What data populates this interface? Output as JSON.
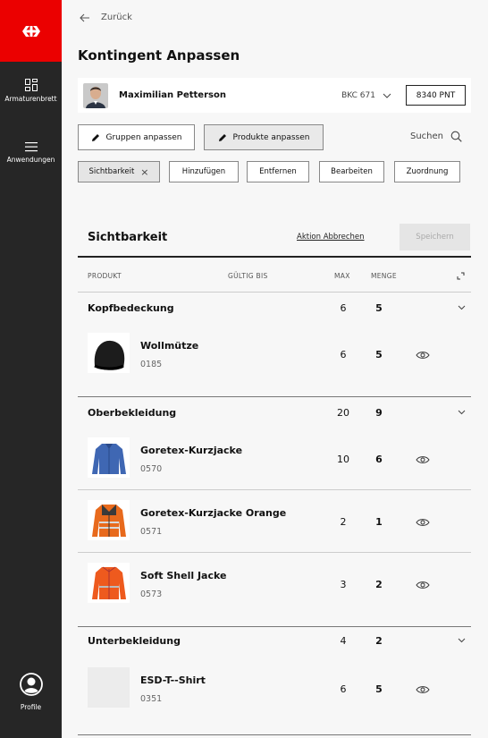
{
  "sidebar": {
    "items": [
      {
        "label": "Armaturenbrett",
        "icon": "dashboard-icon"
      },
      {
        "label": "Anwendungen",
        "icon": "menu-icon"
      },
      {
        "label": "Profile",
        "icon": "profile-icon"
      }
    ],
    "logo": "sbb-logo",
    "colors": {
      "brand": "#eb0000",
      "background": "#262626"
    }
  },
  "header": {
    "back_label": "Zurück",
    "title": "Kontingent Anpassen"
  },
  "user": {
    "name": "Maximilian Petterson",
    "account": "BKC 671",
    "points": "8340 PNT"
  },
  "actions": {
    "groups_label": "Gruppen anpassen",
    "products_label": "Produkte anpassen",
    "search_label": "Suchen"
  },
  "chips": [
    {
      "label": "Sichtbarkeit",
      "active": true
    },
    {
      "label": "Hinzufügen"
    },
    {
      "label": "Entfernen"
    },
    {
      "label": "Bearbeiten"
    },
    {
      "label": "Zuordnung"
    }
  ],
  "panel": {
    "title": "Sichtbarkeit",
    "abort_label": "Aktion Abbrechen",
    "save_label": "Speichern",
    "columns": {
      "product": "PRODUKT",
      "valid_until": "GÜLTIG BIS",
      "max": "MAX",
      "qty": "MENGE"
    }
  },
  "groups": [
    {
      "name": "Kopfbedeckung",
      "max": "6",
      "qty": "5",
      "products": [
        {
          "name": "Wollmütze",
          "code": "0185",
          "max": "6",
          "qty": "5"
        }
      ]
    },
    {
      "name": "Oberbekleidung",
      "max": "20",
      "qty": "9",
      "products": [
        {
          "name": "Goretex-Kurzjacke",
          "code": "0570",
          "max": "10",
          "qty": "6"
        },
        {
          "name": "Goretex-Kurzjacke Orange",
          "code": "0571",
          "max": "2",
          "qty": "1"
        },
        {
          "name": "Soft Shell Jacke",
          "code": "0573",
          "max": "3",
          "qty": "2"
        }
      ]
    },
    {
      "name": "Unterbekleidung",
      "max": "4",
      "qty": "2",
      "products": [
        {
          "name": "ESD-T--Shirt",
          "code": "0351",
          "max": "6",
          "qty": "5"
        }
      ]
    }
  ]
}
